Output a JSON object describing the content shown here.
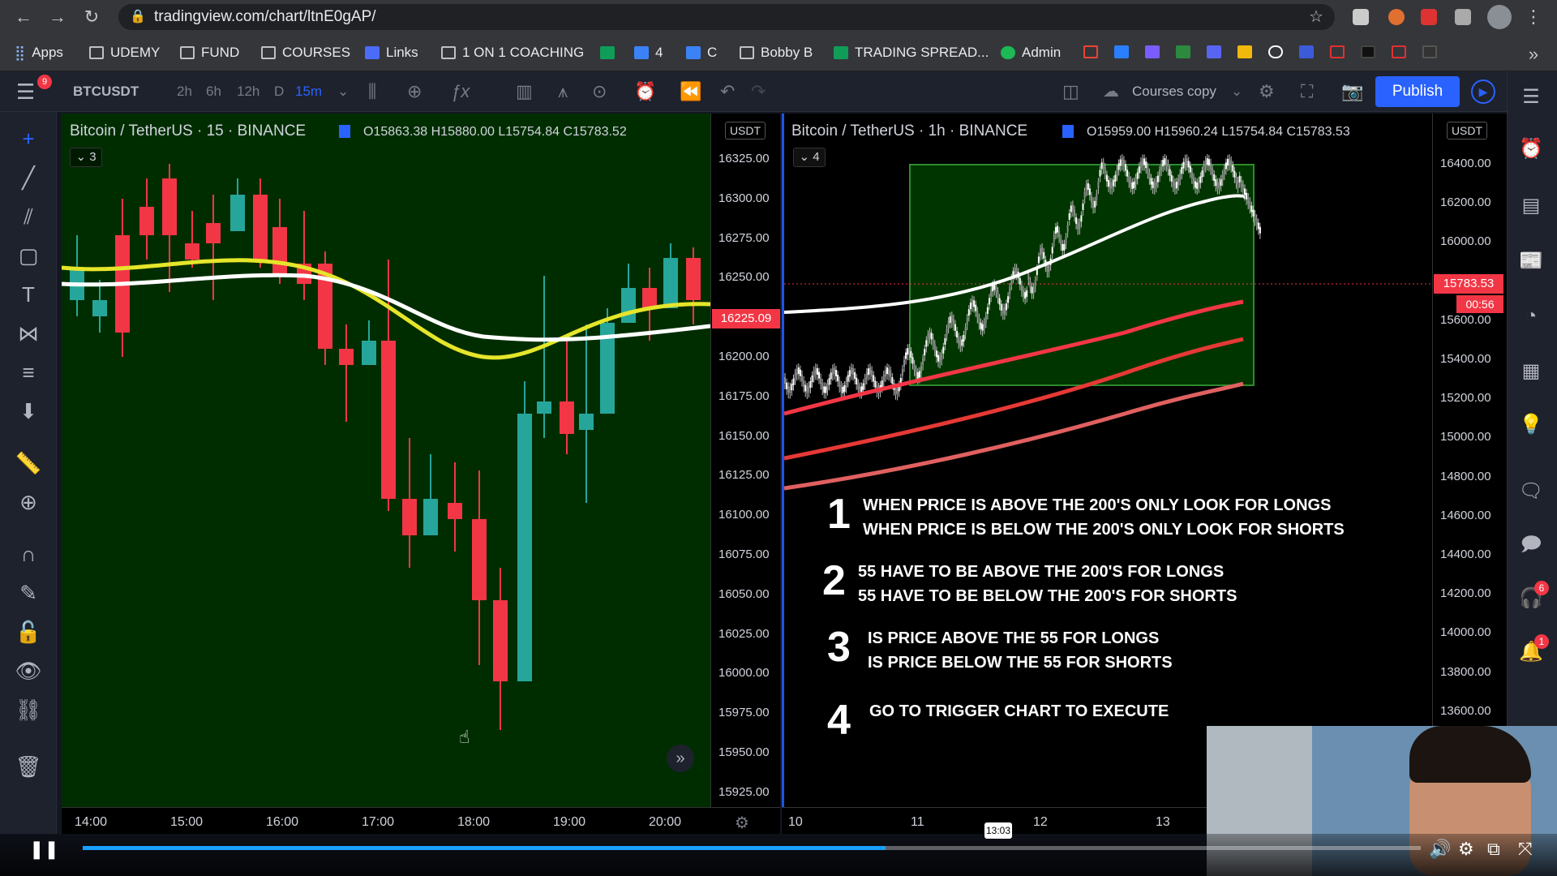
{
  "browser": {
    "url": "tradingview.com/chart/ltnE0gAP/",
    "bookmarks": [
      "Apps",
      "UDEMY",
      "FUND",
      "COURSES",
      "Links",
      "1 ON 1 COACHING",
      "4",
      "C",
      "Bobby B",
      "TRADING SPREAD...",
      "Admin"
    ]
  },
  "toolbar": {
    "symbol": "BTCUSDT",
    "intervals": [
      "2h",
      "6h",
      "12h",
      "D",
      "15m"
    ],
    "active_interval": "15m",
    "layout_name": "Courses copy",
    "publish_label": "Publish",
    "menu_badge": "9"
  },
  "left_chart": {
    "title": "Bitcoin / TetherUS · 15 · BINANCE",
    "ohlc": "O15863.38 H15880.00 L15754.84 C15783.52",
    "indicators_count": "3",
    "currency": "USDT",
    "price_tag": "16225.09",
    "yaxis": [
      "16325.00",
      "16300.00",
      "16275.00",
      "16250.00",
      "16225.00",
      "16200.00",
      "16175.00",
      "16150.00",
      "16125.00",
      "16100.00",
      "16075.00",
      "16050.00",
      "16025.00",
      "16000.00",
      "15975.00",
      "15950.00",
      "15925.00"
    ],
    "xaxis": [
      "14:00",
      "15:00",
      "16:00",
      "17:00",
      "18:00",
      "19:00",
      "20:00"
    ]
  },
  "right_chart": {
    "title": "Bitcoin / TetherUS · 1h · BINANCE",
    "ohlc": "O15959.00 H15960.24 L15754.84 C15783.53",
    "indicators_count": "4",
    "currency": "USDT",
    "price_tag": "15783.53",
    "countdown": "00:56",
    "yaxis": [
      "16400.00",
      "16200.00",
      "16000.00",
      "15800.00",
      "15600.00",
      "15400.00",
      "15200.00",
      "15000.00",
      "14800.00",
      "14600.00",
      "14400.00",
      "14200.00",
      "14000.00",
      "13800.00",
      "13600.00"
    ],
    "xaxis": [
      "10",
      "11",
      "12",
      "13"
    ]
  },
  "rules": [
    {
      "num": "1",
      "lines": [
        "WHEN PRICE IS ABOVE THE 200'S ONLY LOOK FOR LONGS",
        "WHEN PRICE IS BELOW THE 200'S ONLY LOOK FOR SHORTS"
      ]
    },
    {
      "num": "2",
      "lines": [
        "55 HAVE TO BE ABOVE THE 200'S FOR LONGS",
        "55 HAVE TO BE BELOW THE 200'S FOR SHORTS"
      ]
    },
    {
      "num": "3",
      "lines": [
        "IS PRICE ABOVE THE 55 FOR LONGS",
        "IS PRICE BELOW THE 55 FOR SHORTS"
      ]
    },
    {
      "num": "4",
      "lines": [
        "GO TO TRIGGER CHART TO EXECUTE"
      ]
    }
  ],
  "sidebar_badges": {
    "ideas": "6",
    "alerts": "1"
  },
  "player": {
    "hover_time": "13:03",
    "progress": 0.6
  }
}
